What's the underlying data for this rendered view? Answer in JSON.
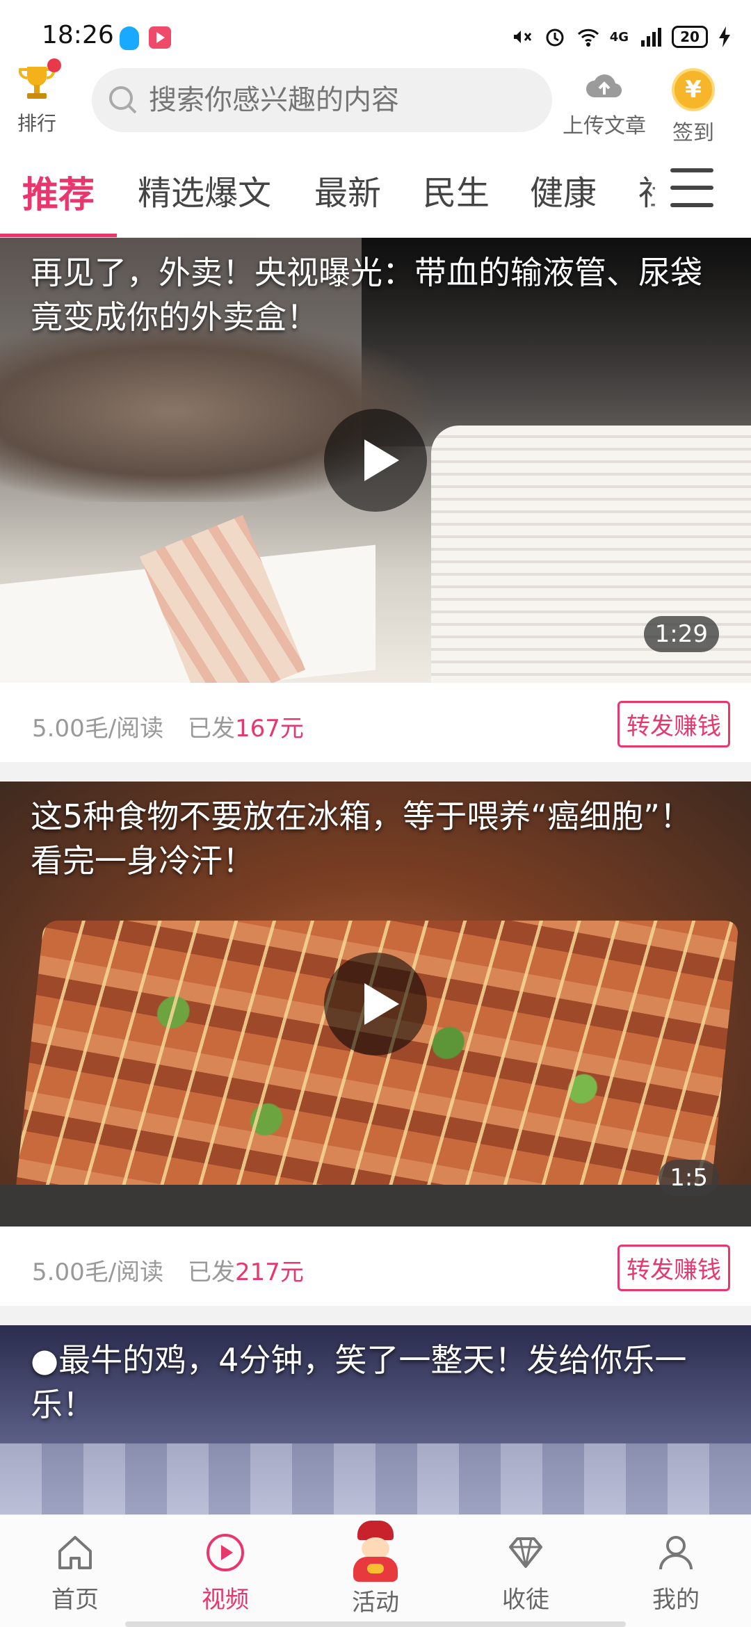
{
  "status_bar": {
    "time": "18:26",
    "network": "4G",
    "battery": "20",
    "icons": [
      "qq-icon",
      "app-icon",
      "mute-icon",
      "alarm-icon",
      "wifi-icon",
      "signal-icon",
      "battery-icon",
      "charging-icon"
    ]
  },
  "header": {
    "rank_label": "排行",
    "search_placeholder": "搜索你感兴趣的内容",
    "upload_label": "上传文章",
    "signin_label": "签到",
    "coin_symbol": "¥"
  },
  "tabs": [
    {
      "label": "推荐",
      "active": true
    },
    {
      "label": "精选爆文",
      "active": false
    },
    {
      "label": "最新",
      "active": false
    },
    {
      "label": "民生",
      "active": false
    },
    {
      "label": "健康",
      "active": false
    },
    {
      "label": "社",
      "active": false
    }
  ],
  "feed": [
    {
      "title": "再见了，外卖！央视曝光：带血的输液管、尿袋竟变成你的外卖盒！",
      "duration": "1:29",
      "price": "5.00毛/阅读",
      "sent_prefix": "已发",
      "sent_amount": "167元",
      "share_label": "转发赚钱"
    },
    {
      "title": "这5种食物不要放在冰箱，等于喂养“癌细胞”！看完一身冷汗！",
      "duration": "1:5",
      "price": "5.00毛/阅读",
      "sent_prefix": "已发",
      "sent_amount": "217元",
      "share_label": "转发赚钱"
    },
    {
      "title": "●最牛的鸡，4分钟，笑了一整天！发给你乐一乐！"
    }
  ],
  "bottom_nav": [
    {
      "label": "首页",
      "icon": "home-icon",
      "active": false
    },
    {
      "label": "视频",
      "icon": "video-play-icon",
      "active": true
    },
    {
      "label": "活动",
      "icon": "fortune-god-icon",
      "active": false
    },
    {
      "label": "收徒",
      "icon": "diamond-icon",
      "active": false
    },
    {
      "label": "我的",
      "icon": "profile-icon",
      "active": false
    }
  ],
  "colors": {
    "accent": "#e8376c",
    "muted_text": "#999999",
    "coin": "#f7b52a"
  }
}
